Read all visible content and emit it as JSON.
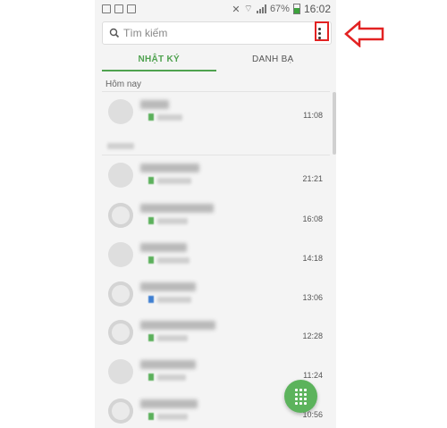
{
  "status_bar": {
    "battery": "67%",
    "time": "16:02"
  },
  "search": {
    "placeholder": "Tìm kiếm"
  },
  "tabs": [
    {
      "label": "NHẬT KÝ",
      "active": true
    },
    {
      "label": "DANH BẠ",
      "active": false
    }
  ],
  "section_today": "Hôm nay",
  "calls": [
    {
      "time": "11:08"
    },
    {
      "time": "21:21"
    },
    {
      "time": "16:08"
    },
    {
      "time": "14:18"
    },
    {
      "time": "13:06"
    },
    {
      "time": "12:28"
    },
    {
      "time": "11:24"
    },
    {
      "time": "10:56"
    }
  ],
  "colors": {
    "accent": "#4fa24f",
    "fab": "#5cb35c",
    "annotation": "#e22222"
  },
  "icons": [
    "search-icon",
    "more-vert-icon",
    "dialpad-icon",
    "callout-arrow-icon"
  ]
}
